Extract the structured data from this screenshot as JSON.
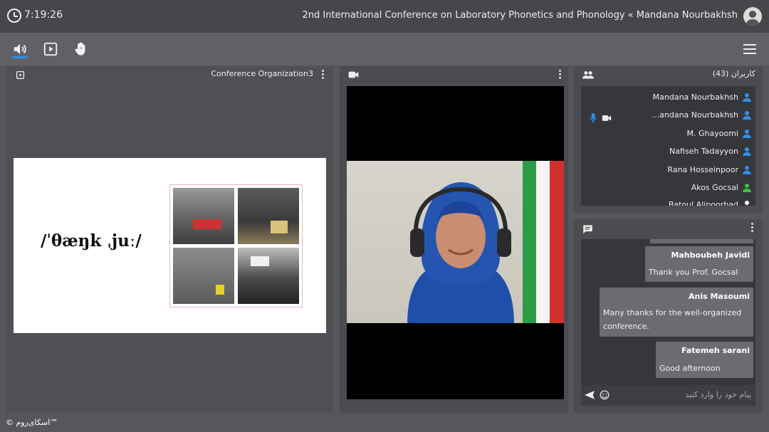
{
  "header": {
    "time": "7:19:26",
    "conference_title": "2nd International Conference on Laboratory Phonetics and Phonology « Mandana Nourbakhsh"
  },
  "toolbar": {
    "icons": [
      "speaker-icon",
      "play-icon",
      "raise-hand-icon",
      "menu-icon"
    ]
  },
  "presentation": {
    "title": "Conference Organization3",
    "slide_text": "/ˈθæŋk ˌjuː/"
  },
  "users": {
    "title": "کاربران (43)",
    "list": [
      {
        "name": "Mandana Nourbakhsh",
        "color": "#2f8fe6"
      },
      {
        "name": "...andana Nourbakhsh",
        "color": "#2f8fe6"
      },
      {
        "name": "M. Ghayoomi",
        "color": "#2f8fe6"
      },
      {
        "name": "Nafiseh Tadayyon",
        "color": "#2f8fe6"
      },
      {
        "name": "Rana Hosseinpoor",
        "color": "#2f8fe6"
      },
      {
        "name": "Akos Gocsal",
        "color": "#3bc23b"
      },
      {
        "name": "Batoul Alipoorbad",
        "color": "#ffffff"
      }
    ]
  },
  "chat": {
    "messages": [
      {
        "name": "Mahboubeh Javidi",
        "text": "Thank you Prof. Gocsal"
      },
      {
        "name": "Anis Masoumi",
        "text": "Many thanks for the well-organized conference."
      },
      {
        "name": "Fatemeh sarani",
        "text": "Good afternoon"
      }
    ],
    "input_placeholder": "پیام خود را وارد کنید"
  },
  "footer": {
    "brand": "© اسکای‌روم™"
  },
  "colors": {
    "accent": "#2f8fe6",
    "online_green": "#3bc23b"
  }
}
